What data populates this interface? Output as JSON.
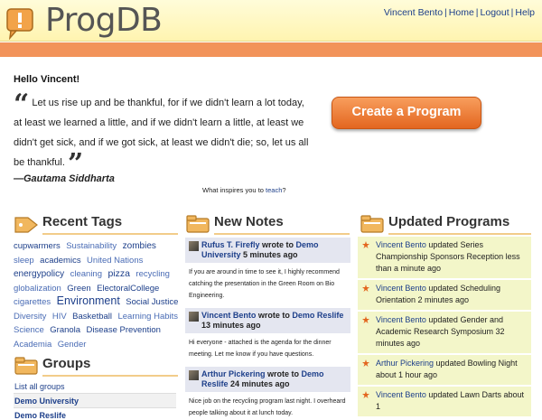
{
  "header": {
    "app_name": "ProgDB",
    "nav": [
      "Vincent Bento",
      "Home",
      "Logout",
      "Help"
    ],
    "nav_separator": "|"
  },
  "welcome": {
    "greeting": "Hello Vincent!",
    "open_quote": "“",
    "close_quote": "”",
    "quote": "Let us rise up and be thankful, for if we didn't learn a lot today, at least we learned a little, and if we didn't learn a little, at least we didn't get sick, and if we got sick, at least we didn't die; so, let us all be thankful.",
    "author": "—Gautama Siddharta",
    "inspires_prefix": "What inspires you to ",
    "inspires_link": "teach",
    "inspires_suffix": "?",
    "create_button": "Create a Program"
  },
  "sections": {
    "tags_title": "Recent Tags",
    "notes_title": "New Notes",
    "programs_title": "Updated Programs",
    "groups_title": "Groups"
  },
  "tags": [
    {
      "text": "cupwarmers",
      "size": 9.5,
      "color": "#1d3f8a"
    },
    {
      "text": "Sustainability",
      "size": 9.5,
      "color": "#4a6cb5"
    },
    {
      "text": "zombies",
      "size": 10,
      "color": "#1d3f8a"
    },
    {
      "text": "sleep",
      "size": 9.5,
      "color": "#4a6cb5"
    },
    {
      "text": "academics",
      "size": 9.5,
      "color": "#1d3f8a"
    },
    {
      "text": "United Nations",
      "size": 9.5,
      "color": "#4a6cb5"
    },
    {
      "text": "energypolicy",
      "size": 10,
      "color": "#1d3f8a"
    },
    {
      "text": "cleaning",
      "size": 9.5,
      "color": "#4a6cb5"
    },
    {
      "text": "pizza",
      "size": 10.5,
      "color": "#1d3f8a"
    },
    {
      "text": "recycling",
      "size": 9.5,
      "color": "#4a6cb5"
    },
    {
      "text": "globalization",
      "size": 9.5,
      "color": "#4a6cb5"
    },
    {
      "text": "Green",
      "size": 9.5,
      "color": "#1d3f8a"
    },
    {
      "text": "ElectoralCollege",
      "size": 9.5,
      "color": "#1d3f8a"
    },
    {
      "text": "cigarettes",
      "size": 9.5,
      "color": "#4a6cb5"
    },
    {
      "text": "Environment",
      "size": 12.5,
      "color": "#1d3f8a"
    },
    {
      "text": "Social Justice",
      "size": 9.5,
      "color": "#1d3f8a"
    },
    {
      "text": "Diversity",
      "size": 9.5,
      "color": "#4a6cb5"
    },
    {
      "text": "HIV",
      "size": 9.5,
      "color": "#4a6cb5"
    },
    {
      "text": "Basketball",
      "size": 9.5,
      "color": "#1d3f8a"
    },
    {
      "text": "Learning Habits",
      "size": 9.5,
      "color": "#4a6cb5"
    },
    {
      "text": "Science",
      "size": 9.5,
      "color": "#4a6cb5"
    },
    {
      "text": "Granola",
      "size": 9.5,
      "color": "#1d3f8a"
    },
    {
      "text": "Disease Prevention",
      "size": 9.5,
      "color": "#1d3f8a"
    },
    {
      "text": "Academia",
      "size": 9.5,
      "color": "#4a6cb5"
    },
    {
      "text": "Gender",
      "size": 9.5,
      "color": "#4a6cb5"
    }
  ],
  "groups": {
    "items": [
      "List all groups",
      "Demo University",
      "Demo Reslife"
    ]
  },
  "notes": [
    {
      "author": "Rufus T. Firefly",
      "wrote_to": "wrote to",
      "target": "Demo University",
      "time": "5 minutes ago",
      "body": "If you are around in time to see it, I highly recommend catching the presentation in the Green Room on Bio Engineering."
    },
    {
      "author": "Vincent Bento",
      "wrote_to": "wrote to",
      "target": "Demo Reslife",
      "time": "13 minutes ago",
      "body": "Hi everyone - attached is the agenda for the dinner meeting. Let me know if you have questions."
    },
    {
      "author": "Arthur Pickering",
      "wrote_to": "wrote to",
      "target": "Demo Reslife",
      "time": "24 minutes ago",
      "body": "Nice job on the recycling program last night. I overheard people talking about it at lunch today."
    }
  ],
  "programs": [
    {
      "who": "Vincent Bento",
      "text": "updated Series Championship Sponsors Reception less than a minute ago"
    },
    {
      "who": "Vincent Bento",
      "text": "updated Scheduling Orientation 2 minutes ago"
    },
    {
      "who": "Vincent Bento",
      "text": "updated Gender and Academic Research Symposium 32 minutes ago"
    },
    {
      "who": "Arthur Pickering",
      "text": "updated Bowling Night about 1 hour ago"
    },
    {
      "who": "Vincent Bento",
      "text": "updated Lawn Darts about 1"
    }
  ],
  "colors": {
    "link": "#1d3f8a",
    "orange": "#f2935a",
    "button": "#e3661f",
    "program_bg": "#f3f6c9",
    "note_bg": "#e4e6f0"
  }
}
